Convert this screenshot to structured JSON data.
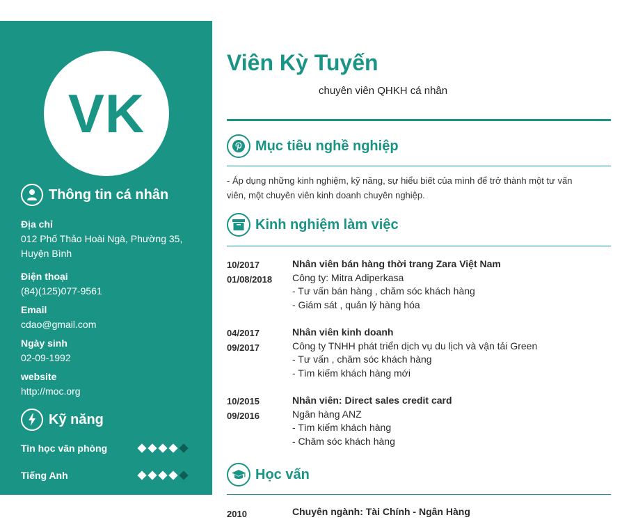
{
  "avatar": {
    "initials": "VK"
  },
  "name": "Viên Kỳ Tuyến",
  "role": "chuyên viên QHKH cá nhân",
  "personal": {
    "heading": "Thông tin cá nhân",
    "address_label": "Địa chỉ",
    "address_line1": "012 Phố Thảo Hoài Ngà, Phường 35,",
    "address_line2": "Huyện Bình",
    "phone_label": "Điện thoại",
    "phone": "(84)(125)077-9561",
    "email_label": "Email",
    "email": "cdao@gmail.com",
    "dob_label": "Ngày sinh",
    "dob": "02-09-1992",
    "website_label": "website",
    "website": "http://moc.org"
  },
  "skills": {
    "heading": "Kỹ năng",
    "items": [
      {
        "name": "Tin học văn phòng",
        "level": 4,
        "max": 5
      },
      {
        "name": "Tiếng Anh",
        "level": 4,
        "max": 5
      }
    ]
  },
  "objective": {
    "heading": "Mục tiêu nghề nghiệp",
    "line1": "- Áp dụng những kinh nghiệm, kỹ năng, sự hiểu biết của mình để trở thành một tư vấn",
    "line2": "viên, một chuyên viên kinh doanh chuyên nghiệp."
  },
  "experience": {
    "heading": "Kinh nghiệm làm việc",
    "jobs": [
      {
        "start": "10/2017",
        "end": "01/08/2018",
        "title": "Nhân viên bán hàng thời trang Zara Việt Nam",
        "company": "Công ty: Mitra Adiperkasa",
        "tasks": [
          "- Tư vấn bán hàng , chăm sóc khách hàng",
          "- Giám sát , quản lý hàng hóa"
        ]
      },
      {
        "start": "04/2017",
        "end": "09/2017",
        "title": "Nhân viên kinh doanh",
        "company": "Công ty TNHH phát triển dịch vụ du lịch và vận tải Green",
        "tasks": [
          "- Tư vấn , chăm sóc khách hàng",
          "- Tìm kiếm khách hàng mới"
        ]
      },
      {
        "start": "10/2015",
        "end": "09/2016",
        "title": "Nhân viên: Direct sales credit card",
        "company": "Ngân hàng ANZ",
        "tasks": [
          "- Tìm kiếm khách hàng",
          "- Chăm sóc khách hàng"
        ]
      }
    ]
  },
  "education": {
    "heading": "Học vấn",
    "items": [
      {
        "year": "2010",
        "title": "Chuyên ngành: Tài Chính - Ngân Hàng"
      }
    ]
  },
  "colors": {
    "accent": "#1a9485",
    "skill_off": "#0f5e55"
  },
  "icons": {
    "personal": "user-icon",
    "skills": "bolt-icon",
    "objective": "pinterest-icon",
    "experience": "archive-icon",
    "education": "graduation-cap-icon"
  }
}
